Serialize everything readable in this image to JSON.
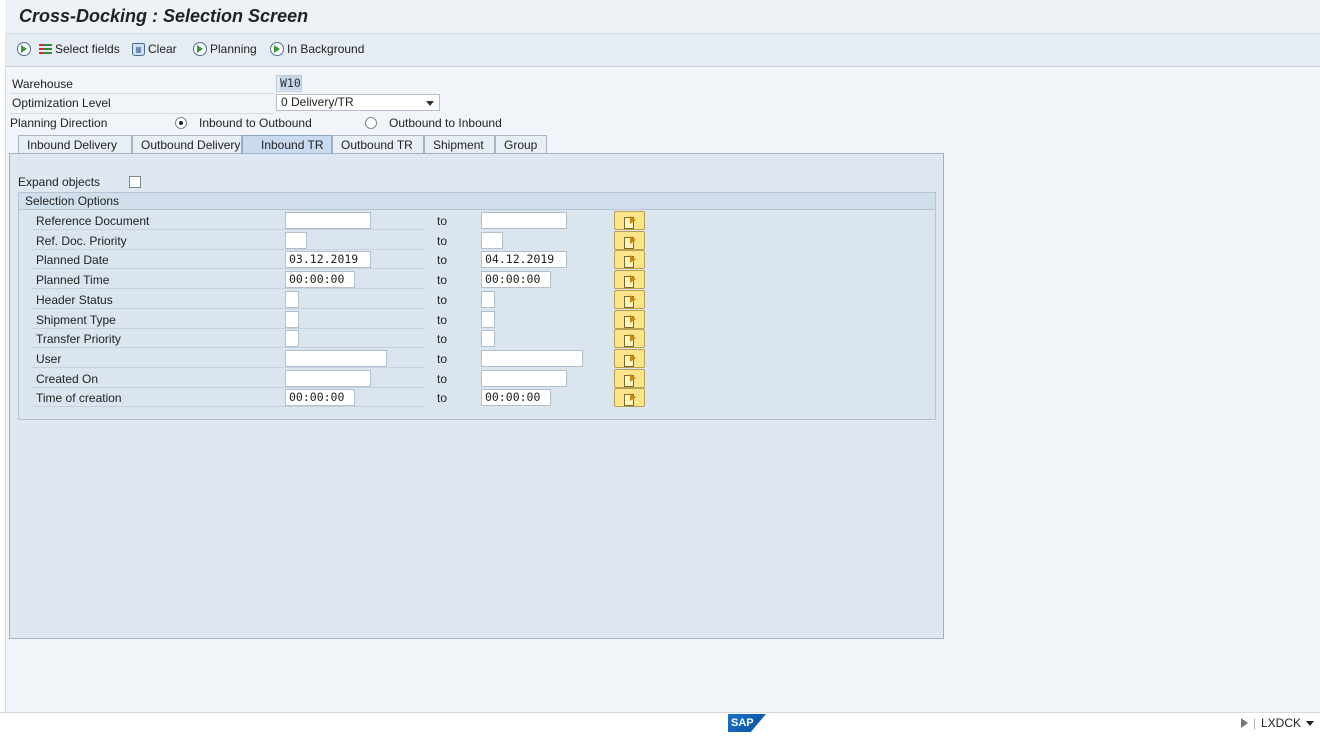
{
  "header": {
    "title": "Cross-Docking : Selection Screen"
  },
  "toolbar": {
    "select_fields": "Select fields",
    "clear": "Clear",
    "planning": "Planning",
    "in_background": "In Background"
  },
  "form": {
    "warehouse_label": "Warehouse",
    "warehouse_value": "W10",
    "opt_level_label": "Optimization Level",
    "opt_level_value": "0 Delivery/TR",
    "planning_dir_label": "Planning Direction",
    "radio_inbound_label": "Inbound to Outbound",
    "radio_outbound_label": "Outbound to Inbound",
    "selected_direction": "Inbound to Outbound"
  },
  "tabs": [
    {
      "label": "Inbound Delivery"
    },
    {
      "label": "Outbound Delivery"
    },
    {
      "label": "Inbound TR"
    },
    {
      "label": "Outbound TR"
    },
    {
      "label": "Shipment"
    },
    {
      "label": "Group"
    }
  ],
  "active_tab": "Inbound TR",
  "panel": {
    "expand_label": "Expand objects",
    "group_title": "Selection Options",
    "to_label": "to",
    "rows": [
      {
        "label": "Reference Document",
        "from": "",
        "to": ""
      },
      {
        "label": "Ref. Doc. Priority",
        "from": "",
        "to": ""
      },
      {
        "label": "Planned Date",
        "from": "03.12.2019",
        "to": "04.12.2019"
      },
      {
        "label": "Planned Time",
        "from": "00:00:00",
        "to": "00:00:00"
      },
      {
        "label": "Header Status",
        "from": "",
        "to": ""
      },
      {
        "label": "Shipment Type",
        "from": "",
        "to": ""
      },
      {
        "label": "Transfer Priority",
        "from": "",
        "to": ""
      },
      {
        "label": "User",
        "from": "",
        "to": ""
      },
      {
        "label": "Created On",
        "from": "",
        "to": ""
      },
      {
        "label": "Time of creation",
        "from": "00:00:00",
        "to": "00:00:00"
      }
    ]
  },
  "footer": {
    "logo_text": "SAP",
    "system": "LXDCK"
  }
}
